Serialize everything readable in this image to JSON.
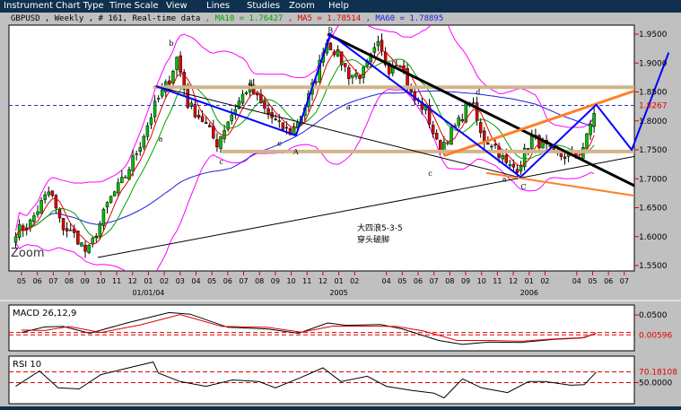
{
  "menu": [
    "Instrument",
    "Chart Type",
    "Time Scale",
    "View",
    "Lines",
    "Studies",
    "Zoom",
    "Help"
  ],
  "info": {
    "instrument": "GBPUSD , Weekly , # 161, Real-time data",
    "ma10": " , MA10 = 1.76427",
    "ma5": " , MA5 = 1.78514",
    "ma60": " , MA60 = 1.78895"
  },
  "colors": {
    "ma10": "#00a000",
    "ma5": "#e00000",
    "ma60": "#2020e0",
    "bands": "#ff00ff",
    "up": "#00c000",
    "down": "#e00000",
    "menu_bg": "#10304f",
    "support": "#d2b48c",
    "trend_orange": "#ff7f27",
    "wave_blue": "#0000ff"
  },
  "chart_data": [
    {
      "type": "candlestick",
      "instrument": "GBPUSD",
      "timeframe": "Weekly",
      "ylim": [
        1.55,
        1.95
      ],
      "y_ticks": [
        "1.9500",
        "1.9000",
        "1.8500",
        "1.8000",
        "1.7500",
        "1.7000",
        "1.6500",
        "1.6000",
        "1.5500"
      ],
      "current_price_label": "1.8267",
      "current_price": 1.8267,
      "x_tick_labels": [
        [
          "2003-05",
          "05"
        ],
        [
          "2003-06",
          "06"
        ],
        [
          "2003-07",
          "07"
        ],
        [
          "2003-08",
          "08"
        ],
        [
          "2003-09",
          "09"
        ],
        [
          "2003-10",
          "10"
        ],
        [
          "2003-11",
          "11"
        ],
        [
          "2003-12",
          "12"
        ],
        [
          "2004-01",
          "01"
        ],
        [
          "2004-02",
          "02"
        ],
        [
          "2004-03",
          "03"
        ],
        [
          "2004-04",
          "04"
        ],
        [
          "2004-05",
          "05"
        ],
        [
          "2004-06",
          "06"
        ],
        [
          "2004-07",
          "07"
        ],
        [
          "2004-08",
          "08"
        ],
        [
          "2004-09",
          "09"
        ],
        [
          "2004-10",
          "10"
        ],
        [
          "2004-11",
          "11"
        ],
        [
          "2004-12",
          "12"
        ],
        [
          "2005-01",
          "01"
        ],
        [
          "2005-02",
          "02"
        ],
        [
          "2005-04",
          "04"
        ],
        [
          "2005-05",
          "05"
        ],
        [
          "2005-06",
          "06"
        ],
        [
          "2005-07",
          "07"
        ],
        [
          "2005-08",
          "08"
        ],
        [
          "2005-09",
          "09"
        ],
        [
          "2005-10",
          "10"
        ],
        [
          "2005-11",
          "11"
        ],
        [
          "2005-12",
          "12"
        ],
        [
          "2006-01",
          "01"
        ],
        [
          "2006-02",
          "02"
        ],
        [
          "2006-04",
          "04"
        ],
        [
          "2006-05",
          "05"
        ],
        [
          "2006-06",
          "06"
        ],
        [
          "2006-07",
          "07"
        ]
      ],
      "year_labels": [
        [
          "2004-01",
          "01/01/04"
        ],
        [
          "2005-01",
          "2005"
        ],
        [
          "2006-01",
          "2006"
        ]
      ],
      "close_path": [
        [
          "2003-04-20",
          1.61
        ],
        [
          "2003-05-15",
          1.62
        ],
        [
          "2003-06-10",
          1.66
        ],
        [
          "2003-06-25",
          1.68
        ],
        [
          "2003-07-15",
          1.62
        ],
        [
          "2003-08-15",
          1.6
        ],
        [
          "2003-09-05",
          1.57
        ],
        [
          "2003-09-20",
          1.6
        ],
        [
          "2003-10-15",
          1.66
        ],
        [
          "2003-11-15",
          1.7
        ],
        [
          "2003-12-15",
          1.76
        ],
        [
          "2004-01-15",
          1.83
        ],
        [
          "2004-02-10",
          1.87
        ],
        [
          "2004-02-25",
          1.91
        ],
        [
          "2004-03-15",
          1.83
        ],
        [
          "2004-04-15",
          1.8
        ],
        [
          "2004-05-10",
          1.76
        ],
        [
          "2004-06-01",
          1.8
        ],
        [
          "2004-06-20",
          1.83
        ],
        [
          "2004-07-10",
          1.86
        ],
        [
          "2004-08-10",
          1.82
        ],
        [
          "2004-09-10",
          1.79
        ],
        [
          "2004-10-01",
          1.78
        ],
        [
          "2004-10-25",
          1.82
        ],
        [
          "2004-11-20",
          1.88
        ],
        [
          "2004-12-05",
          1.94
        ],
        [
          "2004-12-25",
          1.92
        ],
        [
          "2005-01-20",
          1.88
        ],
        [
          "2005-02-15",
          1.88
        ],
        [
          "2005-03-15",
          1.93
        ],
        [
          "2005-04-05",
          1.89
        ],
        [
          "2005-04-25",
          1.91
        ],
        [
          "2005-05-20",
          1.84
        ],
        [
          "2005-06-15",
          1.82
        ],
        [
          "2005-07-10",
          1.75
        ],
        [
          "2005-07-25",
          1.77
        ],
        [
          "2005-08-20",
          1.8
        ],
        [
          "2005-09-10",
          1.84
        ],
        [
          "2005-10-01",
          1.77
        ],
        [
          "2005-10-25",
          1.76
        ],
        [
          "2005-11-20",
          1.72
        ],
        [
          "2005-12-10",
          1.72
        ],
        [
          "2006-01-05",
          1.77
        ],
        [
          "2006-01-25",
          1.76
        ],
        [
          "2006-02-20",
          1.74
        ],
        [
          "2006-03-15",
          1.74
        ],
        [
          "2006-04-05",
          1.74
        ],
        [
          "2006-04-20",
          1.77
        ],
        [
          "2006-05-08",
          1.83
        ]
      ],
      "indicators": [
        "MA10",
        "MA5",
        "MA60",
        "Bollinger"
      ],
      "lines": [
        {
          "name": "resistance",
          "color": "#d2b48c",
          "width": 4,
          "points": [
            [
              "2004-01-10",
              1.858
            ],
            [
              "2006-08-10",
              1.858
            ]
          ]
        },
        {
          "name": "support",
          "color": "#d2b48c",
          "width": 4,
          "points": [
            [
              "2004-05-20",
              1.747
            ],
            [
              "2006-08-10",
              1.747
            ]
          ]
        },
        {
          "name": "long-trend",
          "color": "#000000",
          "width": 1,
          "points": [
            [
              "2003-09-25",
              1.564
            ],
            [
              "2006-08-10",
              1.742
            ]
          ]
        },
        {
          "name": "neckline",
          "color": "#000000",
          "width": 1,
          "points": [
            [
              "2004-01-15",
              1.86
            ],
            [
              "2005-12-10",
              1.703
            ]
          ]
        },
        {
          "name": "down-trend",
          "color": "#000000",
          "width": 3,
          "points": [
            [
              "2004-12-10",
              1.95
            ],
            [
              "2006-08-10",
              1.679
            ]
          ]
        },
        {
          "name": "upper-channel",
          "color": "#ff7f27",
          "width": 3,
          "points": [
            [
              "2005-07-20",
              1.74
            ],
            [
              "2006-08-10",
              1.858
            ]
          ]
        },
        {
          "name": "lower-channel",
          "color": "#ff7f27",
          "width": 2,
          "points": [
            [
              "2005-10-10",
              1.71
            ],
            [
              "2006-08-10",
              1.668
            ]
          ]
        },
        {
          "name": "wave-count",
          "color": "#0000ff",
          "width": 2,
          "points": [
            [
              "2004-01-15",
              1.86
            ],
            [
              "2004-10-10",
              1.775
            ],
            [
              "2004-12-15",
              1.95
            ],
            [
              "2005-12-15",
              1.703
            ],
            [
              "2006-05-08",
              1.828
            ],
            [
              "2006-07-15",
              1.75
            ],
            [
              "2006-09-25",
              1.918
            ]
          ]
        }
      ],
      "wave_labels": [
        [
          "2004-02-10",
          1.93,
          "b"
        ],
        [
          "2004-07-10",
          1.86,
          "d"
        ],
        [
          "2004-12-10",
          1.952,
          "B"
        ],
        [
          "2005-09-20",
          1.845,
          "d"
        ],
        [
          "2004-01-20",
          1.765,
          "a"
        ],
        [
          "2004-09-05",
          1.757,
          "e"
        ],
        [
          "2004-10-05",
          1.742,
          "A"
        ],
        [
          "2004-05-15",
          1.725,
          "c"
        ],
        [
          "2005-01-15",
          1.82,
          "a"
        ],
        [
          "2005-06-20",
          1.705,
          "c"
        ],
        [
          "2005-11-10",
          1.695,
          "a"
        ],
        [
          "2005-12-15",
          1.682,
          "C"
        ]
      ],
      "annotation": [
        "大四浪5-3-5",
        "穿头破脚"
      ],
      "watermark": "Zoom"
    },
    {
      "type": "line",
      "title": "MACD 26,12,9",
      "y_tick": "0.0500",
      "last_value_label": "0.00596",
      "ylim": [
        -0.04,
        0.075
      ],
      "ref_lines": [
        0.00596,
        0.0
      ],
      "series": [
        {
          "color": "#000000",
          "values": [
            [
              "2003-05-01",
              0.006
            ],
            [
              "2003-06-15",
              0.02
            ],
            [
              "2003-07-20",
              0.021
            ],
            [
              "2003-09-10",
              0.004
            ],
            [
              "2003-11-20",
              0.03
            ],
            [
              "2004-02-10",
              0.056
            ],
            [
              "2004-03-20",
              0.052
            ],
            [
              "2004-06-01",
              0.019
            ],
            [
              "2004-08-15",
              0.015
            ],
            [
              "2004-10-15",
              0.004
            ],
            [
              "2004-12-10",
              0.03
            ],
            [
              "2005-01-15",
              0.024
            ],
            [
              "2005-03-20",
              0.026
            ],
            [
              "2005-05-01",
              0.015
            ],
            [
              "2005-07-10",
              -0.014
            ],
            [
              "2005-08-25",
              -0.024
            ],
            [
              "2005-10-15",
              -0.018
            ],
            [
              "2005-12-15",
              -0.019
            ],
            [
              "2006-02-20",
              -0.011
            ],
            [
              "2006-04-10",
              -0.008
            ],
            [
              "2006-05-08",
              0.004
            ]
          ]
        },
        {
          "color": "#e00000",
          "values": [
            [
              "2003-05-01",
              0.012
            ],
            [
              "2003-06-15",
              0.011
            ],
            [
              "2003-08-01",
              0.021
            ],
            [
              "2003-10-01",
              0.006
            ],
            [
              "2003-12-15",
              0.025
            ],
            [
              "2004-03-01",
              0.051
            ],
            [
              "2004-05-20",
              0.021
            ],
            [
              "2004-08-15",
              0.019
            ],
            [
              "2004-10-20",
              0.007
            ],
            [
              "2004-12-20",
              0.022
            ],
            [
              "2005-02-20",
              0.022
            ],
            [
              "2005-04-20",
              0.021
            ],
            [
              "2005-06-10",
              0.01
            ],
            [
              "2005-08-15",
              -0.014
            ],
            [
              "2005-10-15",
              -0.014
            ],
            [
              "2005-12-15",
              -0.016
            ],
            [
              "2006-02-20",
              -0.01
            ],
            [
              "2006-04-15",
              -0.007
            ],
            [
              "2006-05-08",
              0.004
            ]
          ]
        }
      ]
    },
    {
      "type": "line",
      "title": "RSI 10",
      "y_tick": "50.0000",
      "last_value_label": "70.18108",
      "ylim": [
        10,
        100
      ],
      "ref_lines": [
        70.18108,
        50
      ],
      "series": [
        {
          "color": "#000000",
          "values": [
            [
              "2003-04-20",
              43
            ],
            [
              "2003-06-05",
              72
            ],
            [
              "2003-07-10",
              40
            ],
            [
              "2003-08-20",
              38
            ],
            [
              "2003-10-01",
              65
            ],
            [
              "2003-11-20",
              77
            ],
            [
              "2004-01-10",
              89
            ],
            [
              "2004-01-20",
              68
            ],
            [
              "2004-03-01",
              52
            ],
            [
              "2004-04-20",
              43
            ],
            [
              "2004-06-10",
              55
            ],
            [
              "2004-07-30",
              52
            ],
            [
              "2004-09-01",
              40
            ],
            [
              "2004-10-20",
              60
            ],
            [
              "2004-12-01",
              78
            ],
            [
              "2005-01-05",
              52
            ],
            [
              "2005-02-25",
              62
            ],
            [
              "2005-04-01",
              43
            ],
            [
              "2005-05-20",
              35
            ],
            [
              "2005-07-01",
              30
            ],
            [
              "2005-07-20",
              21
            ],
            [
              "2005-08-25",
              57
            ],
            [
              "2005-10-01",
              40
            ],
            [
              "2005-11-20",
              31
            ],
            [
              "2005-12-30",
              52
            ],
            [
              "2006-02-01",
              52
            ],
            [
              "2006-03-20",
              45
            ],
            [
              "2006-04-15",
              46
            ],
            [
              "2006-05-08",
              70
            ]
          ]
        }
      ]
    }
  ]
}
